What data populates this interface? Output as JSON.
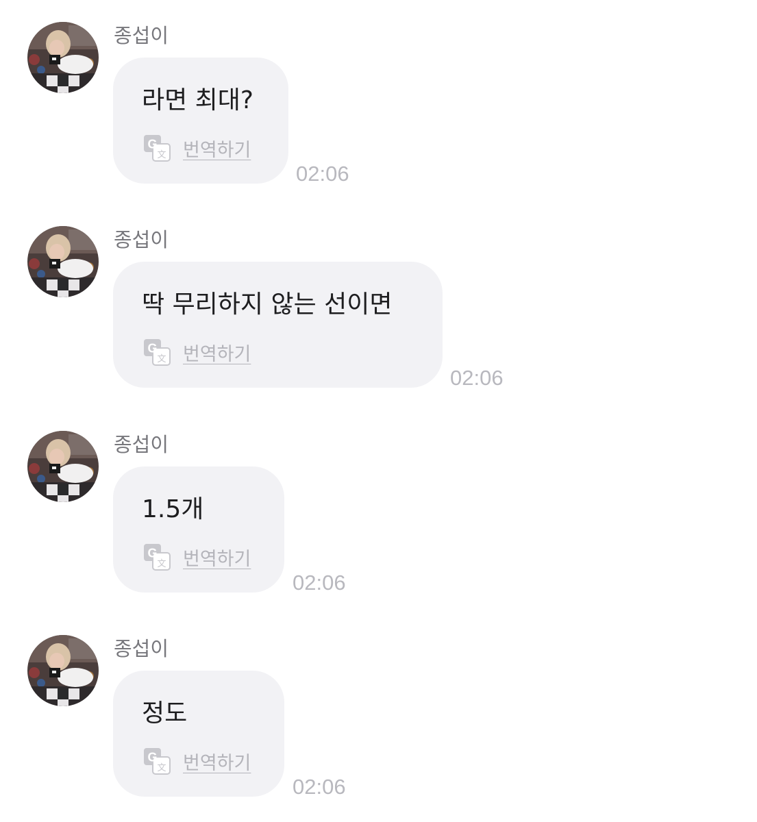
{
  "messages": [
    {
      "sender": "종섭이",
      "text": "라면 최대?",
      "translate_label": "번역하기",
      "time": "02:06"
    },
    {
      "sender": "종섭이",
      "text": "딱 무리하지 않는 선이면",
      "translate_label": "번역하기",
      "time": "02:06"
    },
    {
      "sender": "종섭이",
      "text": "1.5개",
      "translate_label": "번역하기",
      "time": "02:06"
    },
    {
      "sender": "종섭이",
      "text": "정도",
      "translate_label": "번역하기",
      "time": "02:06"
    }
  ],
  "colors": {
    "bubble": "#f2f2f5",
    "sender_text": "#77777c",
    "message_text": "#1d1d1f",
    "secondary_text": "#b8b8be"
  },
  "icons": {
    "avatar": "profile-photo",
    "translate": "google-translate-icon"
  }
}
